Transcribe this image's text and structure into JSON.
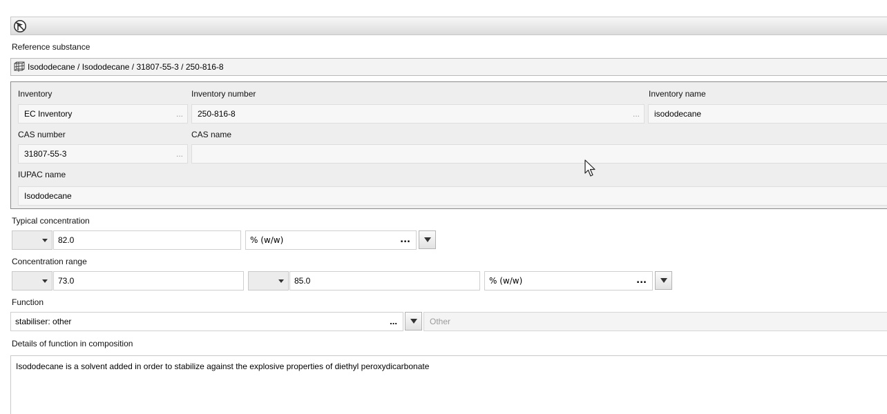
{
  "reference_substance": {
    "label": "Reference substance",
    "value": "Isododecane / Isododecane / 31807-55-3 / 250-816-8"
  },
  "inventory": {
    "col_inventory": "Inventory",
    "col_number": "Inventory number",
    "col_name": "Inventory name",
    "inventory_value": "EC Inventory",
    "number_value": "250-816-8",
    "name_value": "isododecane",
    "cas_number_label": "CAS number",
    "cas_name_label": "CAS name",
    "cas_number_value": "31807-55-3",
    "cas_name_value": "",
    "iupac_label": "IUPAC name",
    "iupac_value": "Isododecane",
    "ellipsis": "..."
  },
  "typical_concentration": {
    "label": "Typical concentration",
    "qualifier": "",
    "value": "82.0",
    "unit": "% (w/w)"
  },
  "concentration_range": {
    "label": "Concentration range",
    "lower_qualifier": "",
    "lower_value": "73.0",
    "upper_qualifier": "",
    "upper_value": "85.0",
    "unit": "% (w/w)"
  },
  "function": {
    "label": "Function",
    "value": "stabiliser: other",
    "other_placeholder": "Other"
  },
  "details": {
    "label": "Details of function in composition",
    "text": "Isododecane is a solvent added in order to stabilize against the explosive properties of diethyl peroxydicarbonate"
  },
  "ui": {
    "ellipsis_button": "..."
  },
  "icons": {
    "top": "flag-icon",
    "reference": "substance-structure-icon",
    "cursor": "mouse-pointer-icon"
  }
}
